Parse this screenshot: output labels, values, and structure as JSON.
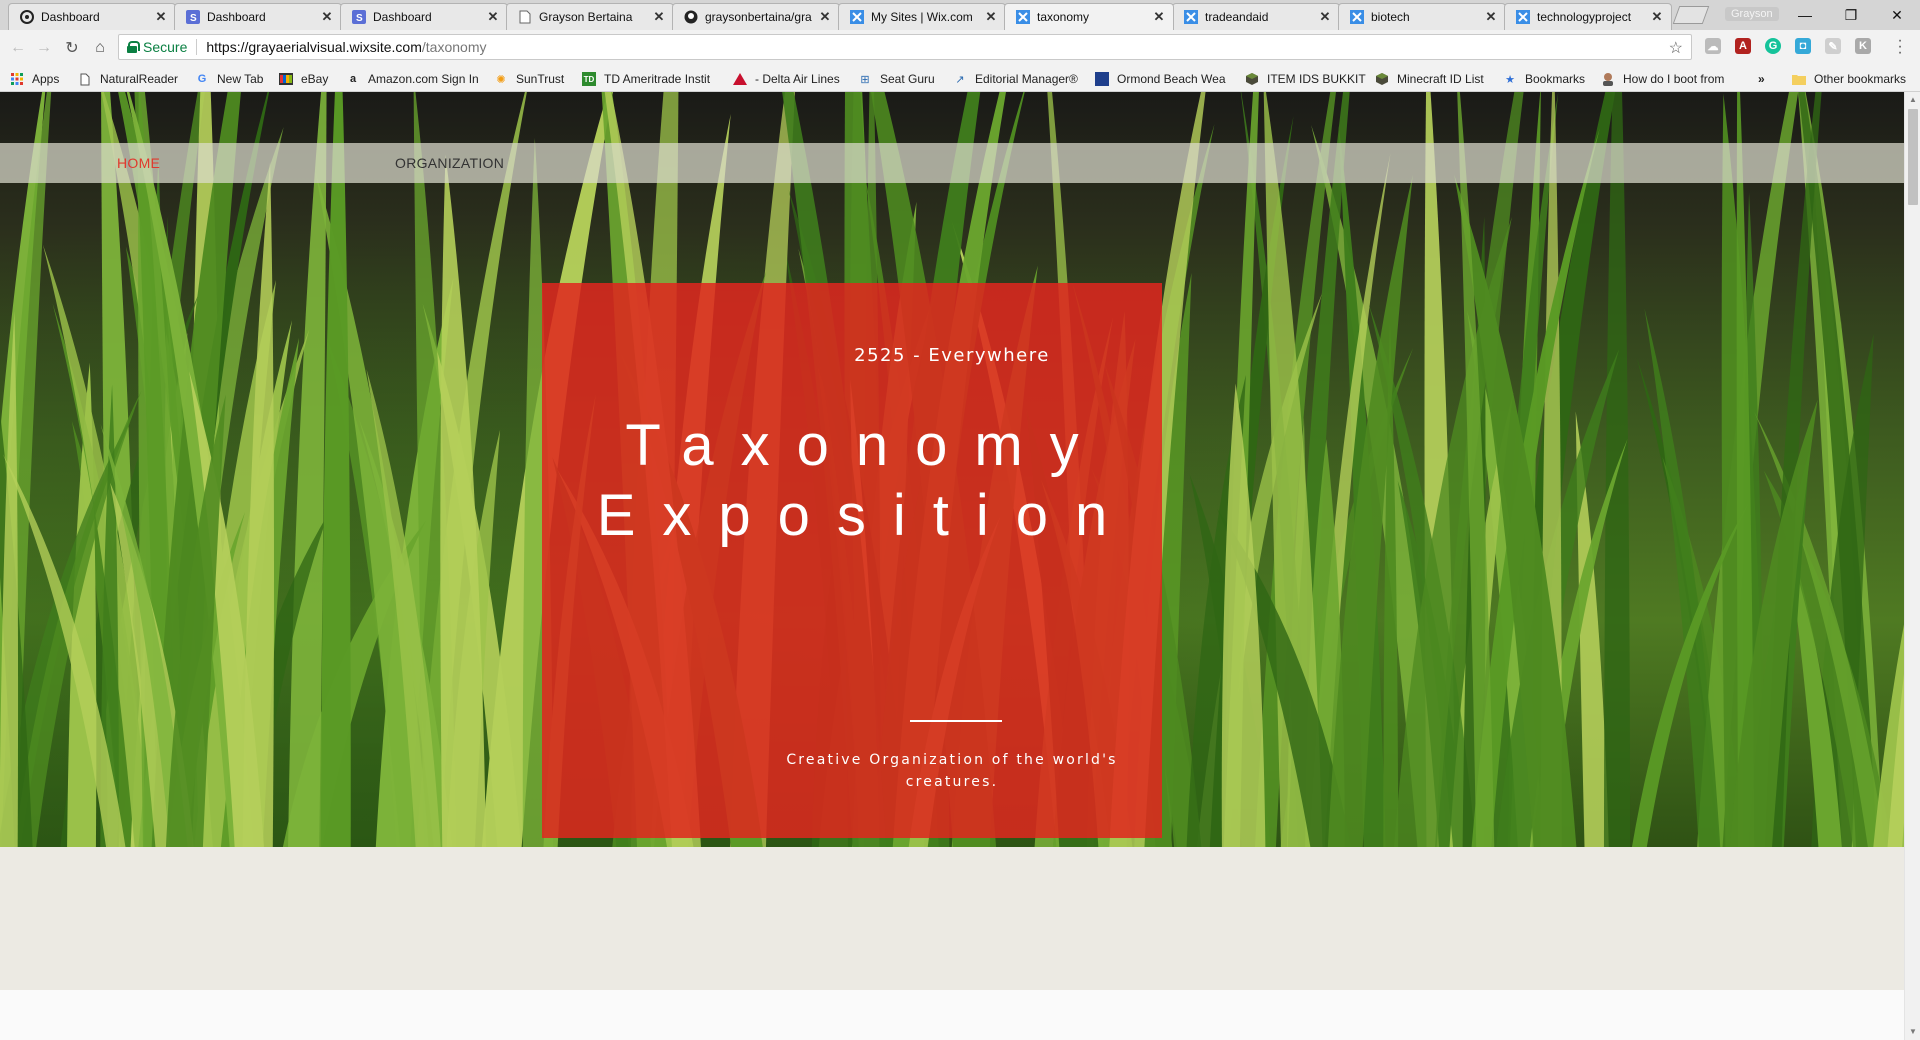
{
  "browser": {
    "tabs": [
      {
        "label": "Dashboard",
        "icon": "squarespace-icon"
      },
      {
        "label": "Dashboard",
        "icon": "s-logo-icon"
      },
      {
        "label": "Dashboard",
        "icon": "s-logo-icon"
      },
      {
        "label": "Grayson Bertaina",
        "icon": "document-icon"
      },
      {
        "label": "graysonbertaina/gra",
        "icon": "github-icon"
      },
      {
        "label": "My Sites | Wix.com",
        "icon": "wix-icon"
      },
      {
        "label": "taxonomy",
        "icon": "wix-icon",
        "active": true
      },
      {
        "label": "tradeandaid",
        "icon": "wix-icon"
      },
      {
        "label": "biotech",
        "icon": "wix-icon"
      },
      {
        "label": "technologyproject",
        "icon": "wix-icon"
      }
    ],
    "profile_name": "Grayson",
    "address": {
      "secure_label": "Secure",
      "url_host": "https://grayaerialvisual.wixsite.com",
      "url_path": "/taxonomy"
    },
    "bookmarks": [
      {
        "label": "Apps"
      },
      {
        "label": "NaturalReader"
      },
      {
        "label": "New Tab"
      },
      {
        "label": "eBay"
      },
      {
        "label": "Amazon.com Sign In"
      },
      {
        "label": "SunTrust"
      },
      {
        "label": "TD Ameritrade Instit"
      },
      {
        "label": "- Delta Air Lines"
      },
      {
        "label": "Seat Guru"
      },
      {
        "label": "Editorial Manager®"
      },
      {
        "label": "Ormond Beach Wea"
      },
      {
        "label": "ITEM IDS BUKKIT"
      },
      {
        "label": "Minecraft ID List"
      },
      {
        "label": "Bookmarks"
      },
      {
        "label": "How do I boot from"
      }
    ],
    "overflow_label": "»",
    "other_bookmarks": "Other bookmarks"
  },
  "site": {
    "nav": {
      "home": "HOME",
      "organization": "ORGANIZATION"
    },
    "hero": {
      "tagline": "2525 - Everywhere",
      "title_line1": "Taxonomy",
      "title_line2": "Exposition",
      "subtitle": "Creative Organization of the world's creatures."
    },
    "colors": {
      "accent": "#e0392d",
      "box": "#e0261e",
      "beige": "#eceae3"
    }
  }
}
